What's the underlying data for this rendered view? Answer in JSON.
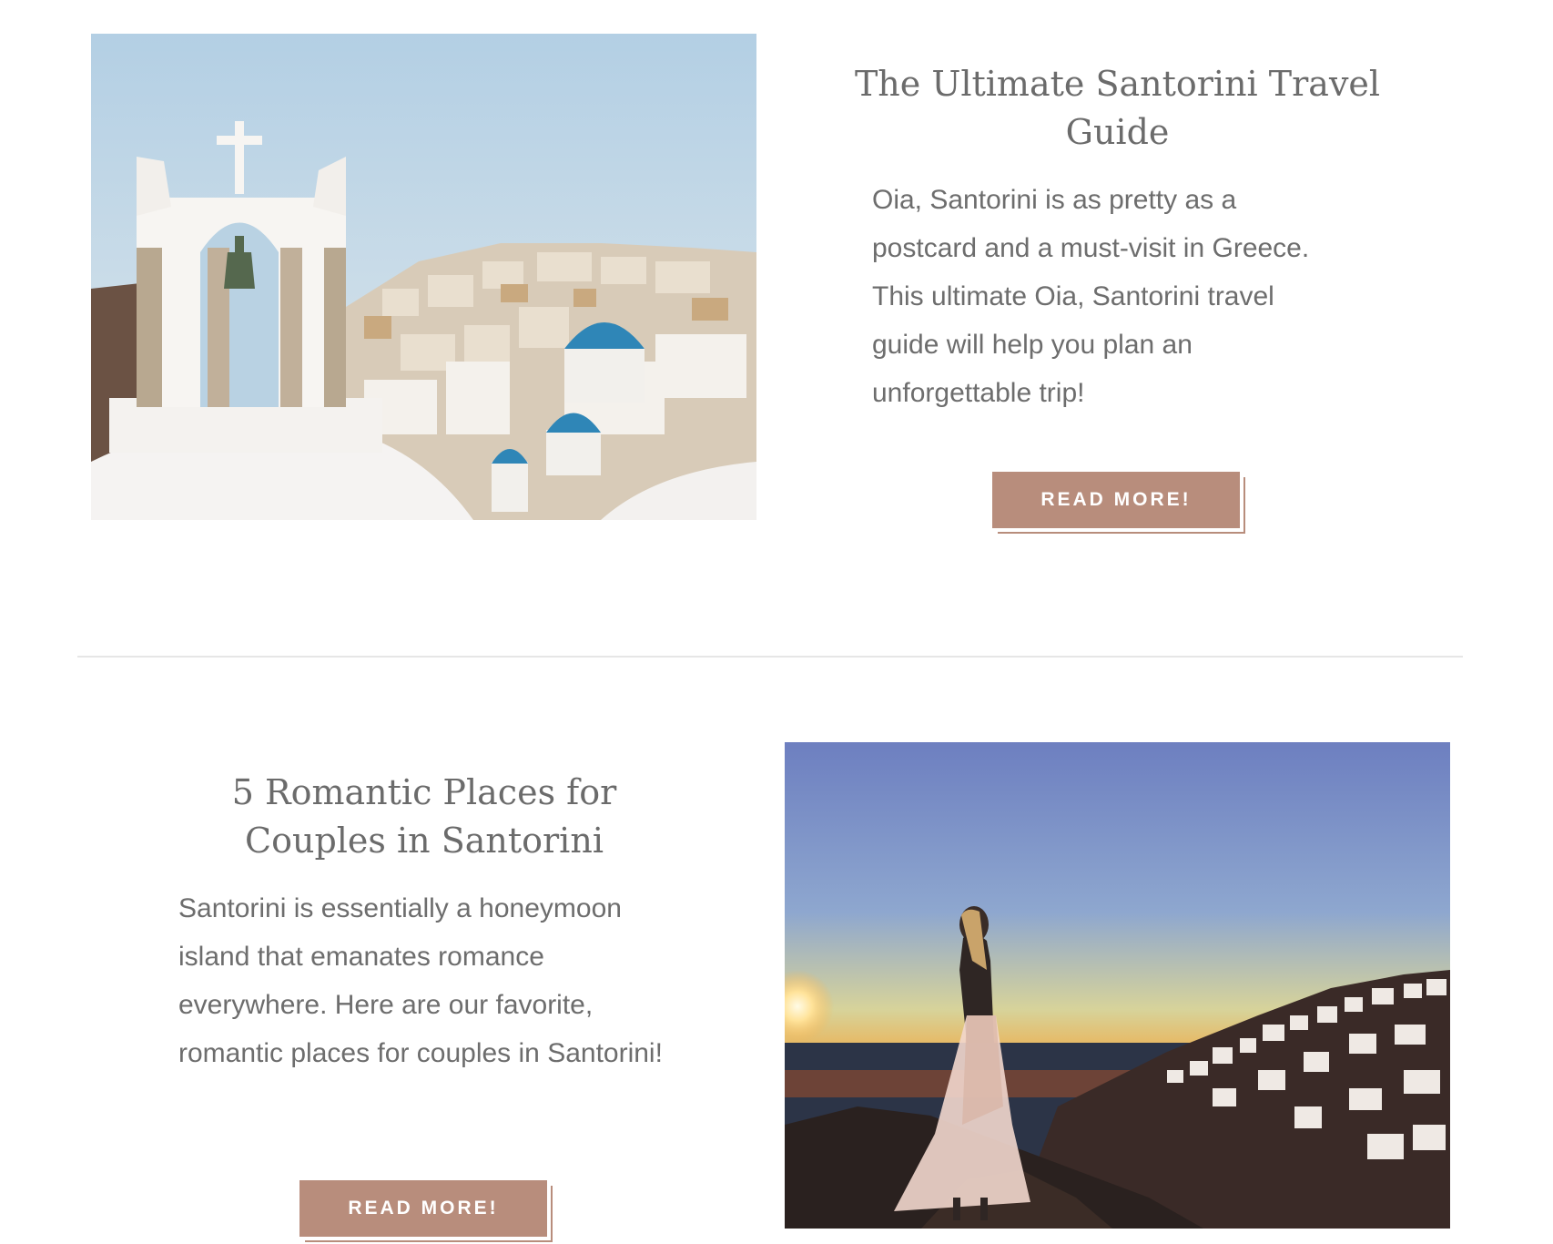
{
  "posts": [
    {
      "title": "The Ultimate Santorini Travel Guide",
      "excerpt": "Oia, Santorini is as pretty as a postcard and a must-visit in Greece. This ultimate Oia, Santorini travel guide will help you plan an unforgettable trip!",
      "button_label": "READ MORE!",
      "image": "santorini-bell-tower-photo"
    },
    {
      "title": "5 Romantic Places for Couples in Santorini",
      "excerpt": "Santorini is essentially a honeymoon island that emanates romance everywhere. Here are our favorite, romantic places for couples in Santorini!",
      "button_label": "READ MORE!",
      "image": "santorini-sunset-woman-photo"
    }
  ],
  "colors": {
    "button": "#b88d7c",
    "title_text": "#6b6b6b",
    "body_text": "#6d6d6d",
    "divider": "#e6e6e6"
  }
}
